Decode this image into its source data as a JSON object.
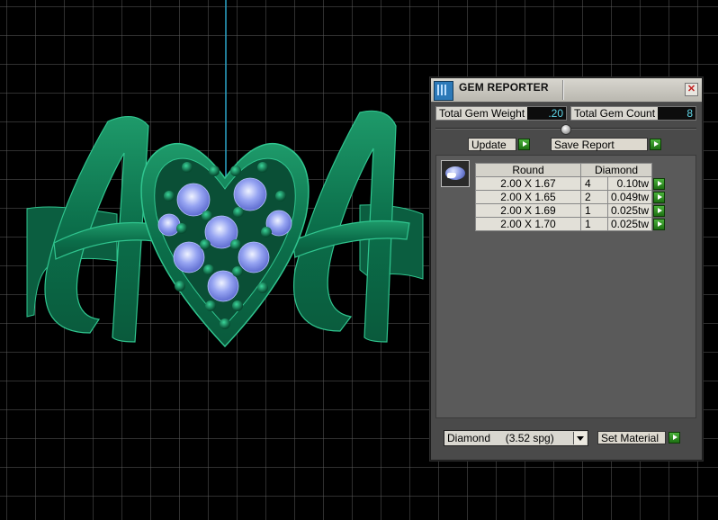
{
  "viewport": {
    "monogram_left": "A",
    "monogram_right": "A",
    "colors": {
      "metal": "#0f7a55",
      "metal_edge": "#30c58f",
      "gem": "#8a98ef",
      "grid": "#6c6c6c",
      "axis": "#2ca6c9"
    }
  },
  "panel": {
    "title": "GEM REPORTER",
    "close_icon": "close-icon",
    "total_gem_weight_label": "Total Gem Weight",
    "total_gem_weight_value": ".20",
    "total_gem_count_label": "Total Gem Count",
    "total_gem_count_value": "8",
    "update_label": "Update",
    "save_report_label": "Save Report",
    "table": {
      "columns": [
        "Round",
        "Diamond"
      ],
      "rows": [
        {
          "size": "2.00 X 1.67",
          "count": "4",
          "weight": "0.10tw"
        },
        {
          "size": "2.00 X 1.65",
          "count": "2",
          "weight": "0.049tw"
        },
        {
          "size": "2.00 X 1.69",
          "count": "1",
          "weight": "0.025tw"
        },
        {
          "size": "2.00 X 1.70",
          "count": "1",
          "weight": "0.025tw"
        }
      ]
    },
    "material_selected": "Diamond     (3.52 spg)",
    "set_material_label": "Set Material",
    "colors": {
      "accent_green": "#2d9a22",
      "readout_text": "#5fd6e8"
    }
  }
}
